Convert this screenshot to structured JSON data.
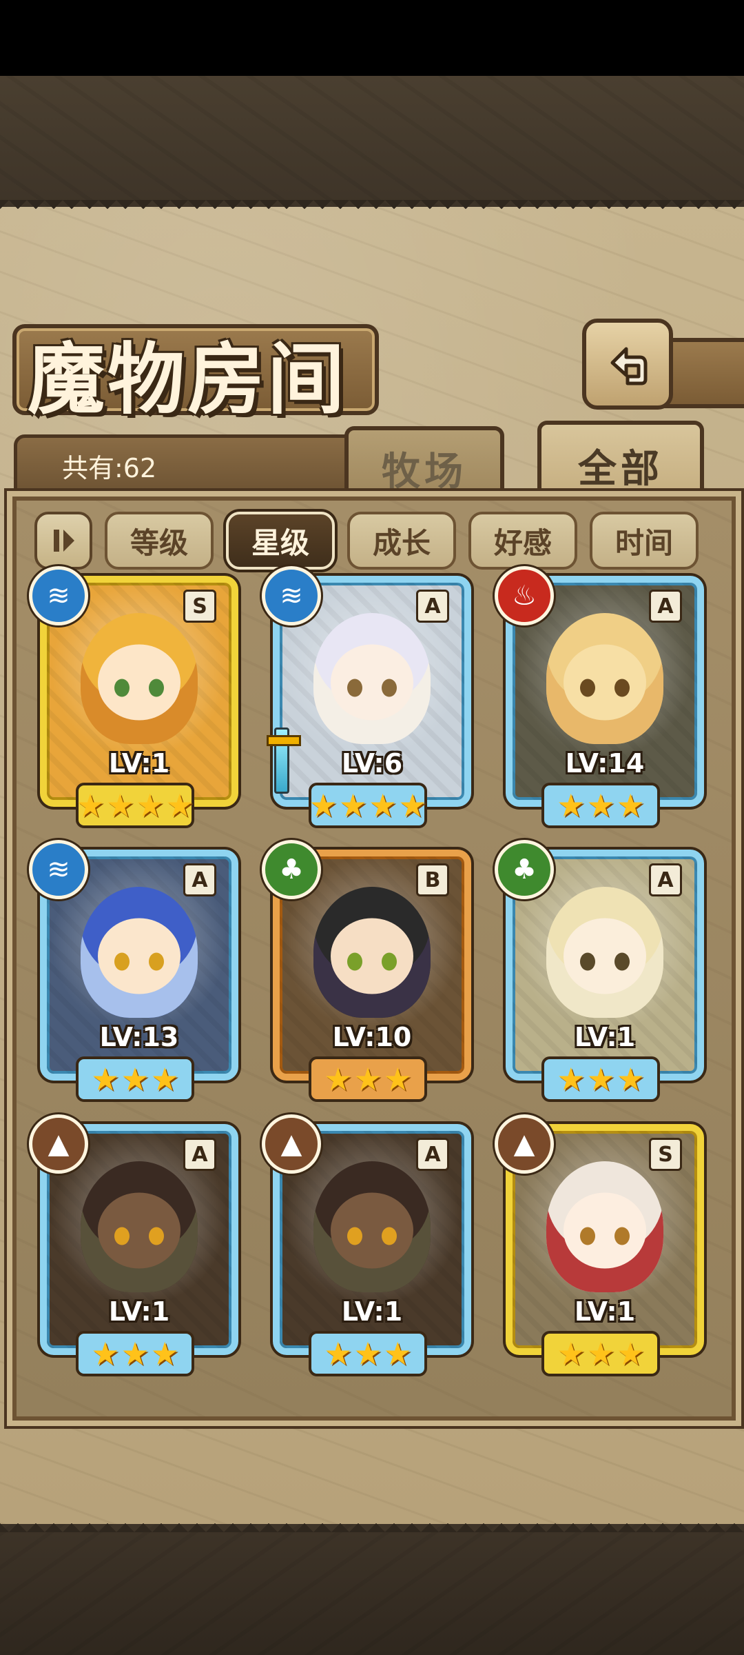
{
  "title": "魔物房间",
  "count_label": "共有:62",
  "tabs": [
    {
      "label": "牧场",
      "active": false
    },
    {
      "label": "全部",
      "active": true
    }
  ],
  "filters": [
    {
      "label": "等级",
      "active": false
    },
    {
      "label": "星级",
      "active": true
    },
    {
      "label": "成长",
      "active": false
    },
    {
      "label": "好感",
      "active": false
    },
    {
      "label": "时间",
      "active": false
    }
  ],
  "icons": {
    "back": "back-arrow-icon",
    "filter_toggle": "pause-toggle-icon",
    "water": "water-element-icon",
    "fire": "fire-element-icon",
    "wood": "leaf-element-icon",
    "earth": "mountain-element-icon"
  },
  "monsters": [
    {
      "rank": "S",
      "level": "LV:1",
      "stars": 4,
      "element": "water",
      "frame": "gold"
    },
    {
      "rank": "A",
      "level": "LV:6",
      "stars": 4,
      "element": "water",
      "frame": "blue"
    },
    {
      "rank": "A",
      "level": "LV:14",
      "stars": 3,
      "element": "fire",
      "frame": "blue"
    },
    {
      "rank": "A",
      "level": "LV:13",
      "stars": 3,
      "element": "water",
      "frame": "blue"
    },
    {
      "rank": "B",
      "level": "LV:10",
      "stars": 3,
      "element": "wood",
      "frame": "orange"
    },
    {
      "rank": "A",
      "level": "LV:1",
      "stars": 3,
      "element": "wood",
      "frame": "blue"
    },
    {
      "rank": "A",
      "level": "LV:1",
      "stars": 3,
      "element": "earth",
      "frame": "blue"
    },
    {
      "rank": "A",
      "level": "LV:1",
      "stars": 3,
      "element": "earth",
      "frame": "blue"
    },
    {
      "rank": "S",
      "level": "LV:1",
      "stars": 3,
      "element": "earth",
      "frame": "gold"
    }
  ],
  "colors": {
    "gold_frame": "#f1d33a",
    "blue_frame": "#8fd4f0",
    "orange_frame": "#e9a14a",
    "water": "#2a7ec8",
    "fire": "#c82a1e",
    "wood": "#3f8a2e",
    "earth": "#7a4a2a",
    "star": "#ffc21a"
  }
}
